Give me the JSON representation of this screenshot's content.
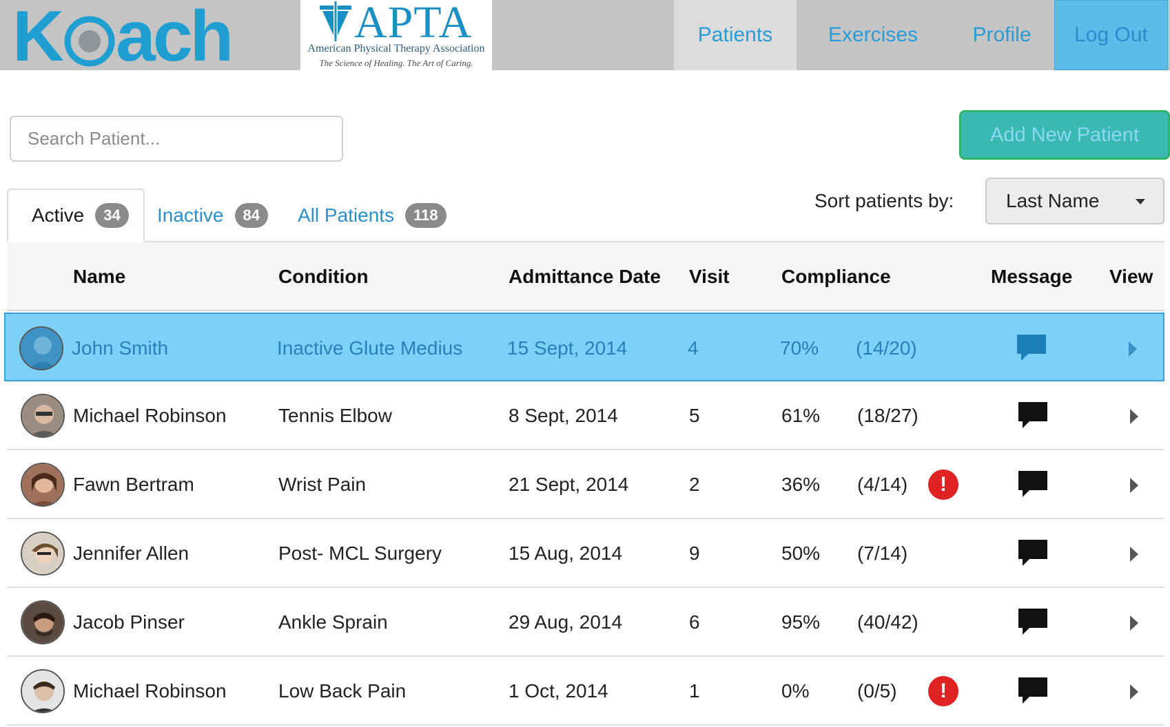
{
  "header": {
    "logo_text": "Koach",
    "partner": {
      "name": "APTA",
      "subtitle": "American Physical Therapy Association",
      "tagline": "The Science of Healing.  The Art of Caring."
    },
    "nav": [
      {
        "label": "Patients",
        "active": true
      },
      {
        "label": "Exercises",
        "active": false
      },
      {
        "label": "Profile",
        "active": false
      },
      {
        "label": "Log Out",
        "active": false
      }
    ]
  },
  "toolbar": {
    "search_placeholder": "Search Patient...",
    "add_button": "Add New Patient"
  },
  "tabs": [
    {
      "label": "Active",
      "count": "34",
      "selected": true
    },
    {
      "label": "Inactive",
      "count": "84",
      "selected": false
    },
    {
      "label": "All Patients",
      "count": "118",
      "selected": false
    }
  ],
  "sort": {
    "label": "Sort patients by:",
    "value": "Last Name"
  },
  "table": {
    "headers": {
      "name": "Name",
      "condition": "Condition",
      "admittance": "Admittance Date",
      "visit": "Visit",
      "compliance": "Compliance",
      "message": "Message",
      "view": "View"
    },
    "rows": [
      {
        "name": "John Smith",
        "condition": "Inactive Glute Medius",
        "date": "15 Sept, 2014",
        "visit": "4",
        "pct": "70%",
        "ratio": "(14/20)",
        "alert": false,
        "selected": true
      },
      {
        "name": "Michael Robinson",
        "condition": "Tennis Elbow",
        "date": "8 Sept, 2014",
        "visit": "5",
        "pct": "61%",
        "ratio": "(18/27)",
        "alert": false,
        "selected": false
      },
      {
        "name": "Fawn Bertram",
        "condition": "Wrist Pain",
        "date": "21 Sept, 2014",
        "visit": "2",
        "pct": "36%",
        "ratio": "(4/14)",
        "alert": true,
        "selected": false
      },
      {
        "name": "Jennifer Allen",
        "condition": "Post- MCL Surgery",
        "date": "15 Aug, 2014",
        "visit": "9",
        "pct": "50%",
        "ratio": "(7/14)",
        "alert": false,
        "selected": false
      },
      {
        "name": "Jacob Pinser",
        "condition": "Ankle Sprain",
        "date": "29 Aug, 2014",
        "visit": "6",
        "pct": "95%",
        "ratio": "(40/42)",
        "alert": false,
        "selected": false
      },
      {
        "name": "Michael Robinson",
        "condition": "Low Back Pain",
        "date": "1 Oct, 2014",
        "visit": "1",
        "pct": "0%",
        "ratio": "(0/5)",
        "alert": true,
        "selected": false
      }
    ]
  },
  "icons": {
    "alert": "exclamation-alert-icon",
    "message": "speech-bubble-icon",
    "view": "chevron-right-icon"
  },
  "colors": {
    "accent": "#2a9bd6",
    "selected_row": "#7dd0f8",
    "add_button": "#3ab8b2",
    "alert": "#e02222"
  }
}
